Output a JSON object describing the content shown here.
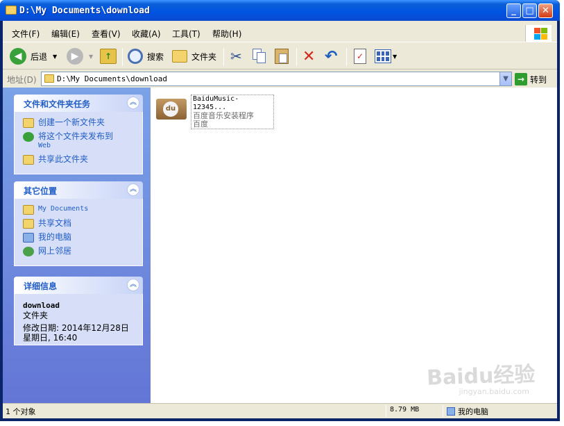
{
  "window": {
    "title": "D:\\My Documents\\download"
  },
  "menu": [
    {
      "label": "文件(F)"
    },
    {
      "label": "编辑(E)"
    },
    {
      "label": "查看(V)"
    },
    {
      "label": "收藏(A)"
    },
    {
      "label": "工具(T)"
    },
    {
      "label": "帮助(H)"
    }
  ],
  "toolbar": {
    "back_label": "后退",
    "search_label": "搜索",
    "folders_label": "文件夹"
  },
  "address": {
    "label": "地址(D)",
    "value": "D:\\My Documents\\download",
    "go_label": "转到"
  },
  "tasks_panel": {
    "title": "文件和文件夹任务",
    "items": [
      {
        "label": "创建一个新文件夹"
      },
      {
        "label": "将这个文件夹发布到",
        "label2": "Web"
      },
      {
        "label": "共享此文件夹"
      }
    ]
  },
  "places_panel": {
    "title": "其它位置",
    "items": [
      {
        "label": "My Documents"
      },
      {
        "label": "共享文档"
      },
      {
        "label": "我的电脑"
      },
      {
        "label": "网上邻居"
      }
    ]
  },
  "details_panel": {
    "title": "详细信息",
    "name": "download",
    "type": "文件夹",
    "modified_line1": "修改日期: 2014年12月28日",
    "modified_line2": "星期日, 16:40"
  },
  "files": [
    {
      "name": "BaiduMusic-12345...",
      "description": "百度音乐安装程序",
      "company": "百度"
    }
  ],
  "status": {
    "count": "1 个对象",
    "size": "8.79 MB",
    "location": "我的电脑"
  },
  "watermark": {
    "text": "Baidu经验",
    "sub": "jingyan.baidu.com"
  },
  "colors": {
    "titlebar": "#0053e1",
    "pane": "#7ba2e7",
    "link": "#215dc6",
    "frame": "#ece9d8"
  }
}
